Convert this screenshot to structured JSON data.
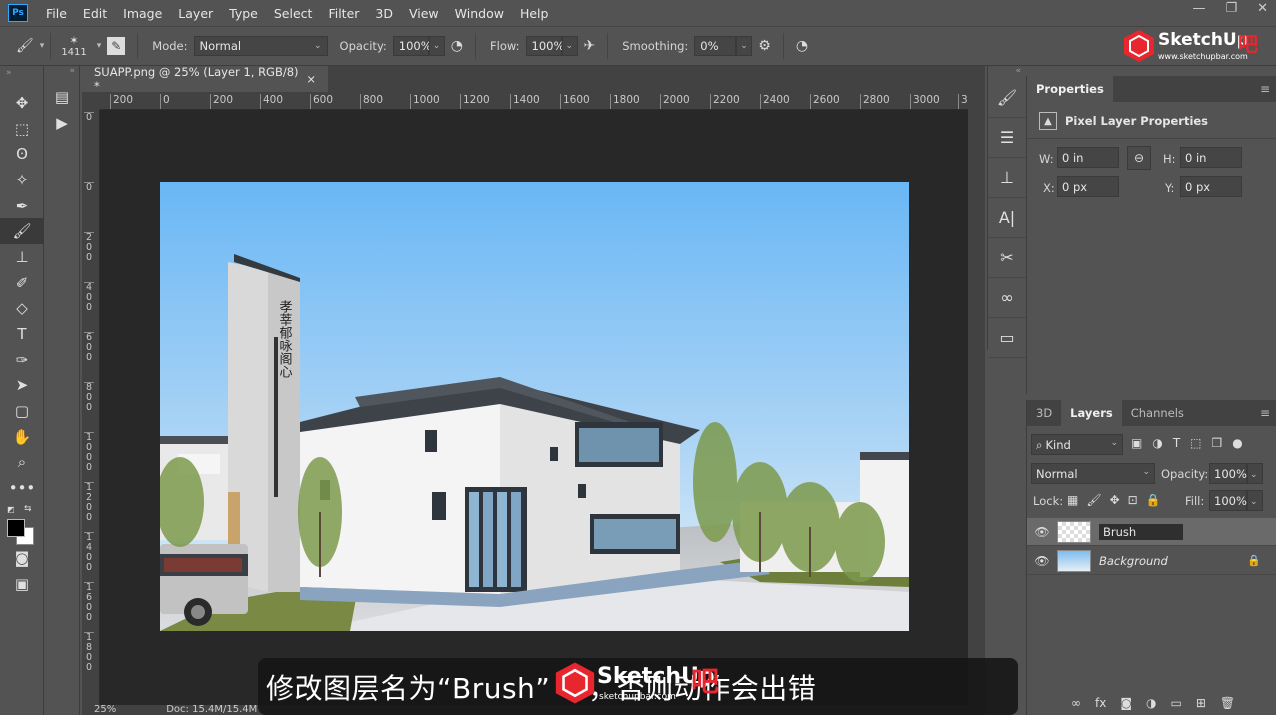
{
  "menubar": {
    "logo": "Ps",
    "items": [
      "File",
      "Edit",
      "Image",
      "Layer",
      "Type",
      "Select",
      "Filter",
      "3D",
      "View",
      "Window",
      "Help"
    ],
    "controls": [
      "—",
      "❐",
      "✕"
    ]
  },
  "options": {
    "brush_size": "1411",
    "mode_label": "Mode:",
    "mode_value": "Normal",
    "opacity_label": "Opacity:",
    "opacity_value": "100%",
    "flow_label": "Flow:",
    "flow_value": "100%",
    "smoothing_label": "Smoothing:",
    "smoothing_value": "0%"
  },
  "document": {
    "tab_title": "SUAPP.png @ 25% (Layer 1, RGB/8) *",
    "tab_close": "×",
    "ruler_top": [
      "200",
      "0",
      "200",
      "400",
      "600",
      "800",
      "1000",
      "1200",
      "1400",
      "1600",
      "1800",
      "2000",
      "2200",
      "2400",
      "2600",
      "2800",
      "3000",
      "3"
    ],
    "ruler_left": [
      "0",
      "2 0 0",
      "4 0 0",
      "6 0 0",
      "8 0 0",
      "1 0 0 0",
      "1 2 0 0",
      "1 4 0 0",
      "1 6 0 0",
      "1 8 0 0"
    ],
    "zoom": "25%",
    "doc_info": "Doc: 15.4M/15.4M"
  },
  "artwork": {
    "tower_text": "孝莘郁咏阁心"
  },
  "properties": {
    "tab": "Properties",
    "section": "Pixel Layer Properties",
    "w_label": "W:",
    "w_value": "0 in",
    "h_label": "H:",
    "h_value": "0 in",
    "x_label": "X:",
    "x_value": "0 px",
    "y_label": "Y:",
    "y_value": "0 px"
  },
  "layers_panel": {
    "tabs": [
      "3D",
      "Layers",
      "Channels"
    ],
    "filter_label": "Kind",
    "blend_mode": "Normal",
    "opacity_label": "Opacity:",
    "opacity_value": "100%",
    "lock_label": "Lock:",
    "fill_label": "Fill:",
    "fill_value": "100%",
    "layers": [
      {
        "name": "Brush",
        "editing": true
      },
      {
        "name": "Background",
        "locked": true
      }
    ],
    "footer_icons": [
      "link-icon",
      "fx-icon",
      "mask-icon",
      "adjustment-icon",
      "folder-icon",
      "new-layer-icon",
      "trash-icon"
    ]
  },
  "caption": {
    "text": "修改图层名为“Brush”       写，否则动作会出错"
  },
  "watermark": {
    "brand": "SketchUp",
    "suffix": "吧",
    "url": "www.sketchupbar.com",
    "url_short": "sketchupbar.com"
  },
  "colors": {
    "accent": "#31a8ff",
    "sky_top": "#6bb9f5",
    "sky_bottom": "#dcecf7",
    "watermark_red": "#e8262e"
  }
}
